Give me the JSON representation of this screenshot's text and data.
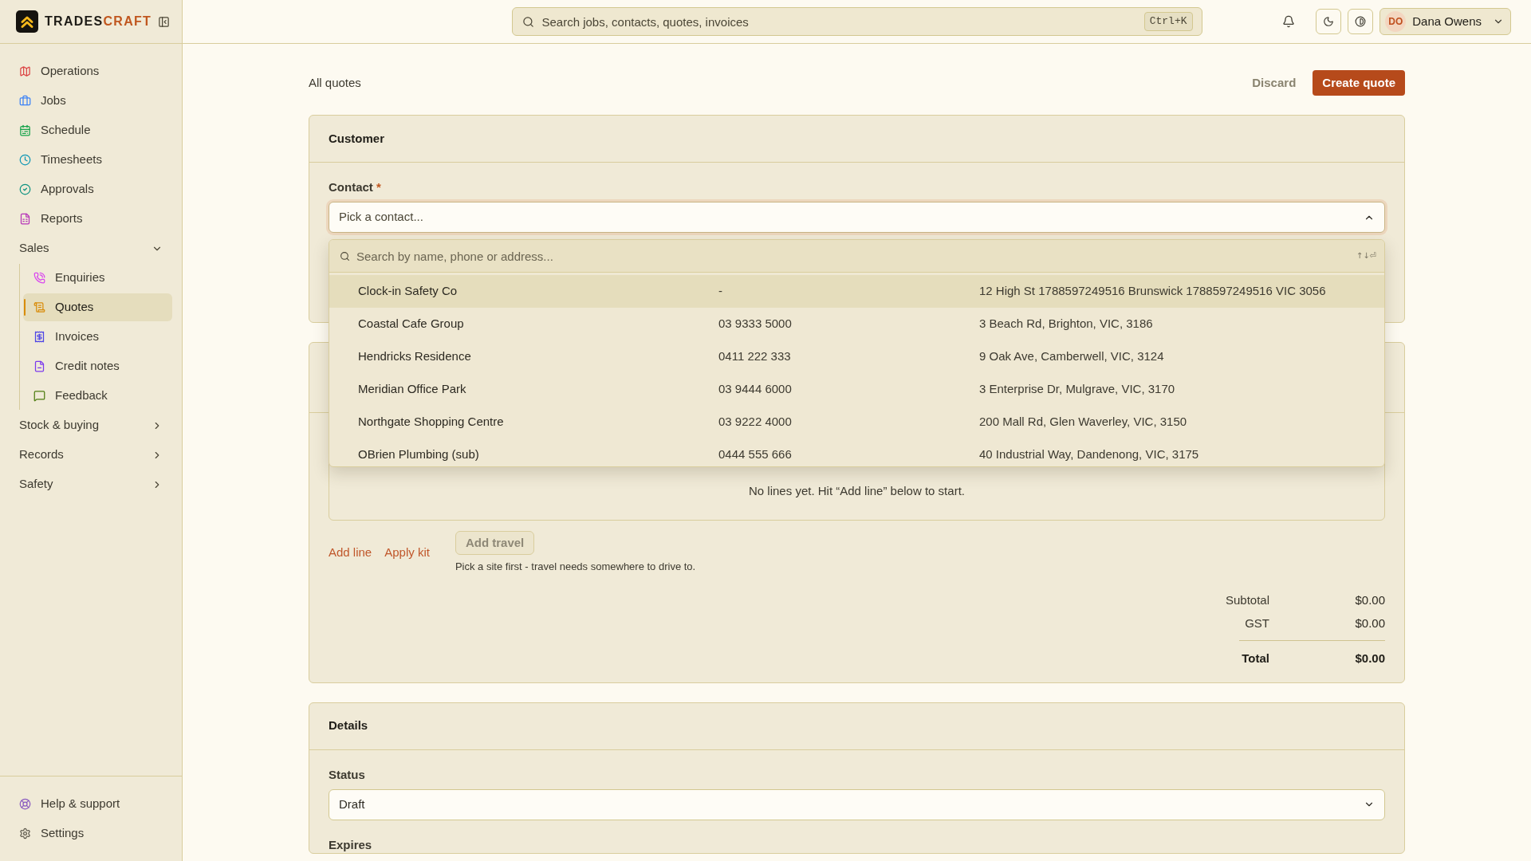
{
  "sidebar": {
    "brand": {
      "name_dark": "TRADES",
      "name_accent": "CRAFT"
    },
    "nav": [
      {
        "kind": "link",
        "label": "Operations",
        "selected": false
      },
      {
        "kind": "link",
        "label": "Jobs",
        "selected": false
      },
      {
        "kind": "link",
        "label": "Schedule",
        "selected": false
      },
      {
        "kind": "link",
        "label": "Timesheets",
        "selected": false
      },
      {
        "kind": "link",
        "label": "Approvals",
        "selected": false
      },
      {
        "kind": "link",
        "label": "Reports",
        "selected": false
      },
      {
        "kind": "group",
        "label": "Sales",
        "expanded": true,
        "selected": false,
        "children": [
          {
            "kind": "link",
            "label": "Enquiries",
            "selected": false
          },
          {
            "kind": "link",
            "label": "Quotes",
            "selected": true
          },
          {
            "kind": "link",
            "label": "Invoices",
            "selected": false
          },
          {
            "kind": "link",
            "label": "Credit notes",
            "selected": false
          },
          {
            "kind": "link",
            "label": "Feedback",
            "selected": false
          }
        ]
      },
      {
        "kind": "group",
        "label": "Stock & buying",
        "expanded": false,
        "selected": false
      },
      {
        "kind": "group",
        "label": "Records",
        "expanded": false,
        "selected": false
      },
      {
        "kind": "group",
        "label": "Safety",
        "expanded": false,
        "selected": false
      }
    ],
    "footer": [
      {
        "kind": "link",
        "label": "Help & support",
        "selected": false
      },
      {
        "kind": "link",
        "label": "Settings",
        "selected": false
      }
    ]
  },
  "topbar": {
    "search": {
      "placeholder": "Search jobs, contacts, quotes, invoices",
      "shortcut": "Ctrl+K"
    },
    "user": {
      "initials": "DO",
      "name": "Dana Owens"
    }
  },
  "page_header": {
    "back_link": "All quotes",
    "actions": [
      {
        "kind": "secondary",
        "label": "Discard"
      },
      {
        "kind": "primary",
        "label": "Create quote"
      }
    ]
  },
  "customer_card": {
    "title": "Customer",
    "contact_field": {
      "label": "Contact",
      "required_mark": "*",
      "placeholder": "Pick a contact...",
      "expanded": true,
      "dropdown": {
        "search_placeholder": "Search by name, phone or address...",
        "key_hint": "↑↓⏎",
        "options": [
          {
            "name": "Clock-in Safety Co",
            "phone": "-",
            "address": "12 High St 1788597249516 Brunswick 1788597249516 VIC 3056",
            "selected": true
          },
          {
            "name": "Coastal Cafe Group",
            "phone": "03 9333 5000",
            "address": "3 Beach Rd, Brighton, VIC, 3186",
            "selected": false
          },
          {
            "name": "Hendricks Residence",
            "phone": "0411 222 333",
            "address": "9 Oak Ave, Camberwell, VIC, 3124",
            "selected": false
          },
          {
            "name": "Meridian Office Park",
            "phone": "03 9444 6000",
            "address": "3 Enterprise Dr, Mulgrave, VIC, 3170",
            "selected": false
          },
          {
            "name": "Northgate Shopping Centre",
            "phone": "03 9222 4000",
            "address": "200 Mall Rd, Glen Waverley, VIC, 3150",
            "selected": false
          },
          {
            "name": "OBrien Plumbing (sub)",
            "phone": "0444 555 666",
            "address": "40 Industrial Way, Dandenong, VIC, 3175",
            "selected": false
          }
        ]
      }
    }
  },
  "lines_card": {
    "empty_text": "No lines yet. Hit “Add line” below to start.",
    "actions": [
      {
        "kind": "link",
        "label": "Add line",
        "disabled": false
      },
      {
        "kind": "link",
        "label": "Apply kit",
        "disabled": false
      },
      {
        "kind": "button",
        "label": "Add travel",
        "disabled": true,
        "hint": "Pick a site first - travel needs somewhere to drive to."
      }
    ],
    "totals": [
      {
        "kind": "line",
        "label": "Subtotal",
        "value": "$0.00"
      },
      {
        "kind": "line",
        "label": "GST",
        "value": "$0.00"
      },
      {
        "kind": "total",
        "label": "Total",
        "value": "$0.00"
      }
    ]
  },
  "details_card": {
    "title": "Details",
    "fields": [
      {
        "kind": "select",
        "label": "Status",
        "value": "Draft"
      },
      {
        "kind": "label",
        "label": "Expires"
      }
    ]
  }
}
